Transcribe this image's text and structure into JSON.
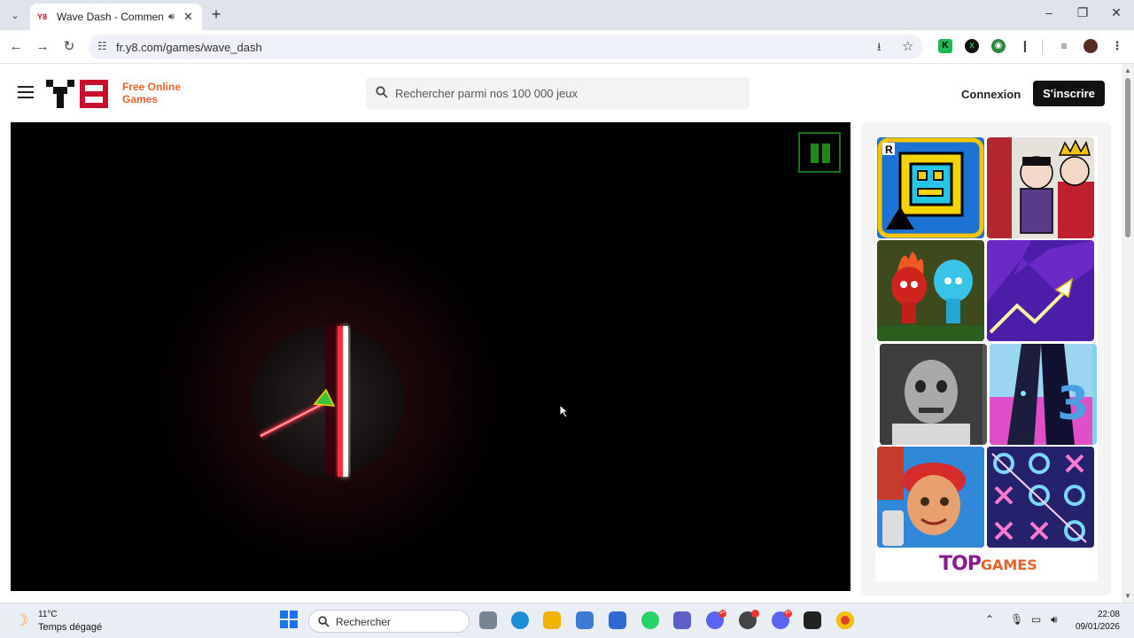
{
  "browser": {
    "tab_title": "Wave Dash - Commencez à",
    "tab_favicon": "Y8",
    "url": "fr.y8.com/games/wave_dash"
  },
  "site": {
    "brand_line1": "Free Online",
    "brand_line2": "Games",
    "search_placeholder": "Rechercher parmi nos 100 000 jeux",
    "login_label": "Connexion",
    "signup_label": "S'inscrire",
    "accent": "#e8632b"
  },
  "game": {
    "pause_icon": "pause-icon",
    "laser_color": "#ff2a3c"
  },
  "sidebar": {
    "tiles": [
      {
        "name": "geometry-dash",
        "icon": "geometry-dash-tile"
      },
      {
        "name": "king-jester",
        "icon": "king-tile"
      },
      {
        "name": "fireboy-watergirl",
        "icon": "fire-water-tile"
      },
      {
        "name": "wave-dash",
        "icon": "wave-tile"
      },
      {
        "name": "granny",
        "icon": "granny-tile"
      },
      {
        "name": "piano-tiles-3",
        "icon": "piano-tile",
        "label": "3"
      },
      {
        "name": "subway-surfers",
        "icon": "subway-tile"
      },
      {
        "name": "tic-tac-toe",
        "icon": "tictactoe-tile"
      }
    ],
    "footer_top": "TOP",
    "footer_games": "GAMES"
  },
  "taskbar": {
    "temperature": "11°C",
    "condition": "Temps dégagé",
    "search_label": "Rechercher",
    "time": "22:08",
    "date": "09/01/2026",
    "discord_badge": "9+"
  }
}
